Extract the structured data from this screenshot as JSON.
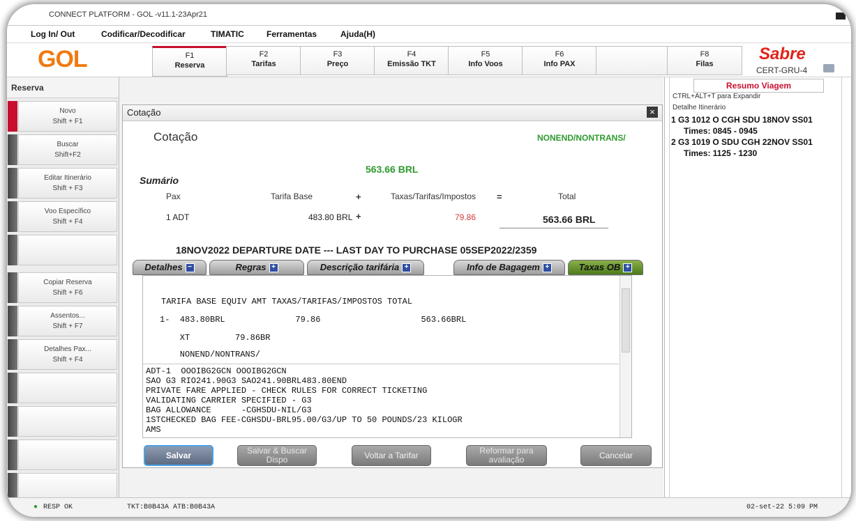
{
  "window_title": "CONNECT PLATFORM - GOL -v11.1-23Apr21",
  "menu": [
    "Log In/ Out",
    "Codificar/Decodificar",
    "TIMATIC",
    "Ferramentas",
    "Ajuda(H)"
  ],
  "logo": "GOL",
  "fkeys": [
    {
      "key": "F1",
      "label": "Reserva"
    },
    {
      "key": "F2",
      "label": "Tarifas"
    },
    {
      "key": "F3",
      "label": "Preço"
    },
    {
      "key": "F4",
      "label": "Emissão TKT"
    },
    {
      "key": "F5",
      "label": "Info Voos"
    },
    {
      "key": "F6",
      "label": "Info PAX"
    },
    {
      "key": "F8",
      "label": "Filas"
    }
  ],
  "brand": "Sabre",
  "pcc": "CERT-GRU-4",
  "sidebar": {
    "title": "Reserva",
    "items": [
      {
        "label": "Novo",
        "shortcut": "Shift + F1"
      },
      {
        "label": "Buscar",
        "shortcut": "Shift+F2"
      },
      {
        "label": "Editar Itinerário",
        "shortcut": "Shift + F3"
      },
      {
        "label": "Voo Específico",
        "shortcut": "Shift + F4"
      },
      {
        "label": "Copiar Reserva",
        "shortcut": "Shift + F6"
      },
      {
        "label": "Assentos...",
        "shortcut": "Shift + F7"
      },
      {
        "label": "Detalhes Pax...",
        "shortcut": "Shift + F4"
      }
    ]
  },
  "dialog": {
    "window_title": "Cotação",
    "heading": "Cotação",
    "restriction": "NONEND/NONTRANS/",
    "grand_total": "563.66 BRL",
    "summary_title": "Sumário",
    "col_pax": "Pax",
    "col_base": "Tarifa Base",
    "plus": "+",
    "col_taxes": "Taxas/Tarifas/Impostos",
    "equals": "=",
    "col_total": "Total",
    "row": {
      "pax": "1 ADT",
      "base": "483.80 BRL",
      "plus": "+",
      "taxes": "79.86",
      "total": "563.66 BRL"
    },
    "deadline": "18NOV2022 DEPARTURE DATE --- LAST DAY TO PURCHASE 05SEP2022/2359",
    "tabs": [
      "Detalhes",
      "Regras",
      "Descrição tarifária",
      "Info de Bagagem",
      "Taxas OB"
    ],
    "tab_icons": [
      "−",
      "+",
      "+",
      "+",
      "+"
    ],
    "fare_lines": [
      "TARIFA BASE  EQUIV AMT  TAXAS/TARIFAS/IMPOSTOS  TOTAL",
      "1-  483.80BRL              79.86                    563.66BRL",
      "    XT         79.86BR",
      "    NONEND/NONTRANS/"
    ],
    "detail_lines": [
      "ADT-1  OOOIBG2GCN OOOIBG2GCN",
      "SAO G3 RIO241.90G3 SAO241.90BRL483.80END",
      "PRIVATE FARE APPLIED - CHECK RULES FOR CORRECT TICKETING",
      "VALIDATING CARRIER SPECIFIED - G3",
      "BAG ALLOWANCE      -CGHSDU-NIL/G3",
      "1STCHECKED BAG FEE-CGHSDU-BRL95.00/G3/UP TO 50 POUNDS/23 KILOGR",
      "AMS"
    ],
    "buttons": [
      "Salvar",
      "Salvar & Buscar Dispo",
      "Voltar a Tarifar",
      "Reformar para avaliação",
      "Cancelar"
    ]
  },
  "summary_panel": {
    "title": "Resumo Viagem",
    "hint": "CTRL+ALT+T para Expandir",
    "subtitle": "Detalhe Itinerário",
    "segments": [
      {
        "line": "1 G3 1012 O CGH SDU  18NOV SS01",
        "times": "Times: 0845 - 0945"
      },
      {
        "line": "2 G3 1019 O SDU CGH  22NOV SS01",
        "times": "Times: 1125 - 1230"
      }
    ]
  },
  "status": {
    "resp": "RESP OK",
    "tkt": "TKT:B0B43A ATB:B0B43A",
    "datetime": "02-set-22 5:09 PM"
  },
  "colors": {
    "gol_orange": "#f07a12",
    "sabre_red": "#e2231a",
    "green_text": "#2e9a2e",
    "tax_red": "#d23b3b"
  }
}
